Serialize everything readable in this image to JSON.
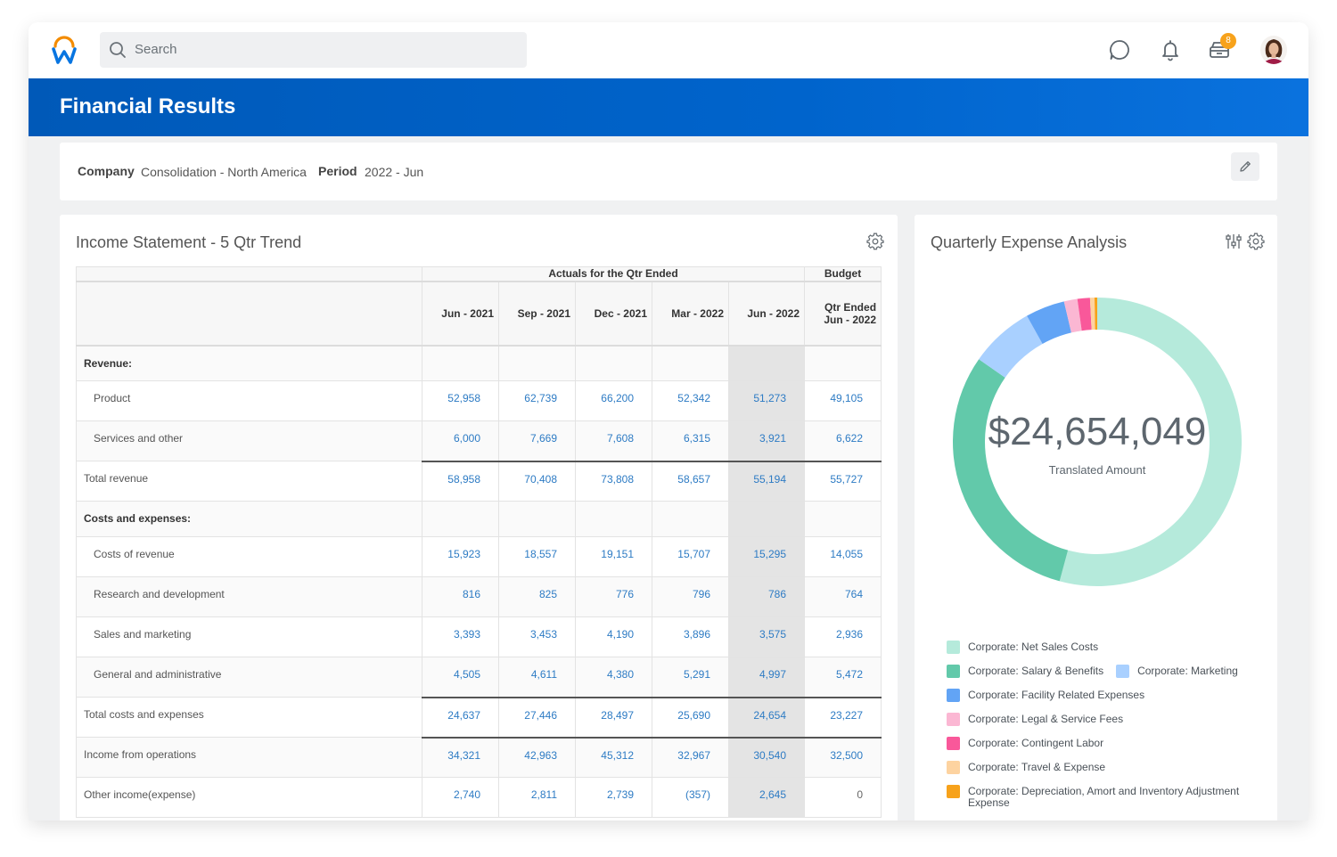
{
  "topbar": {
    "search_placeholder": "Search",
    "notification_badge": "8",
    "colors": {
      "logo_arc": "#f38b00",
      "logo_w": "#0875e1",
      "badge": "#f7a21b"
    }
  },
  "banner": {
    "title": "Financial Results",
    "color": "#0064cc"
  },
  "filters": {
    "company_label": "Company",
    "company_value": "Consolidation - North America",
    "period_label": "Period",
    "period_value": "2022 - Jun"
  },
  "income_statement": {
    "title": "Income Statement - 5 Qtr Trend",
    "group_headers": {
      "actuals": "Actuals for the Qtr Ended",
      "budget": "Budget"
    },
    "columns": [
      "Jun - 2021",
      "Sep - 2021",
      "Dec - 2021",
      "Mar - 2022",
      "Jun - 2022",
      "Qtr Ended Jun - 2022"
    ],
    "rows": [
      {
        "label": "Revenue:",
        "type": "section",
        "values": [
          "",
          "",
          "",
          "",
          "",
          ""
        ]
      },
      {
        "label": "Product",
        "type": "item",
        "values": [
          "52,958",
          "62,739",
          "66,200",
          "52,342",
          "51,273",
          "49,105"
        ]
      },
      {
        "label": "Services and other",
        "type": "item",
        "values": [
          "6,000",
          "7,669",
          "7,608",
          "6,315",
          "3,921",
          "6,622"
        ]
      },
      {
        "label": "Total revenue",
        "type": "total",
        "values": [
          "58,958",
          "70,408",
          "73,808",
          "58,657",
          "55,194",
          "55,727"
        ]
      },
      {
        "label": "Costs and expenses:",
        "type": "section",
        "values": [
          "",
          "",
          "",
          "",
          "",
          ""
        ]
      },
      {
        "label": "Costs of revenue",
        "type": "item",
        "values": [
          "15,923",
          "18,557",
          "19,151",
          "15,707",
          "15,295",
          "14,055"
        ]
      },
      {
        "label": "Research and development",
        "type": "item",
        "values": [
          "816",
          "825",
          "776",
          "796",
          "786",
          "764"
        ]
      },
      {
        "label": "Sales and marketing",
        "type": "item",
        "values": [
          "3,393",
          "3,453",
          "4,190",
          "3,896",
          "3,575",
          "2,936"
        ]
      },
      {
        "label": "General and administrative",
        "type": "item",
        "values": [
          "4,505",
          "4,611",
          "4,380",
          "5,291",
          "4,997",
          "5,472"
        ]
      },
      {
        "label": "Total costs and expenses",
        "type": "total",
        "values": [
          "24,637",
          "27,446",
          "28,497",
          "25,690",
          "24,654",
          "23,227"
        ]
      },
      {
        "label": "Income from operations",
        "type": "total",
        "values": [
          "34,321",
          "42,963",
          "45,312",
          "32,967",
          "30,540",
          "32,500"
        ]
      },
      {
        "label": "Other income(expense)",
        "type": "plain",
        "values": [
          "2,740",
          "2,811",
          "2,739",
          "(357)",
          "2,645",
          "0"
        ]
      }
    ]
  },
  "expense_analysis": {
    "title": "Quarterly Expense Analysis",
    "total_amount": "$24,654,049",
    "total_label": "Translated Amount"
  },
  "chart_data": {
    "type": "pie",
    "variant": "donut",
    "title": "Quarterly Expense Analysis",
    "center_value": "$24,654,049",
    "center_label": "Translated Amount",
    "legend_position": "bottom",
    "slices": [
      {
        "name": "Corporate: Net Sales Costs",
        "percent": 54.2,
        "color": "#b5eadb"
      },
      {
        "name": "Corporate: Salary & Benefits",
        "percent": 30.5,
        "color": "#62c9aa"
      },
      {
        "name": "Corporate: Marketing",
        "percent": 7.2,
        "color": "#a9d0ff"
      },
      {
        "name": "Corporate: Facility Related Expenses",
        "percent": 4.4,
        "color": "#62a4f5"
      },
      {
        "name": "Corporate: Legal & Service Fees",
        "percent": 1.5,
        "color": "#fbb7d3"
      },
      {
        "name": "Corporate: Contingent Labor",
        "percent": 1.4,
        "color": "#f9589a"
      },
      {
        "name": "Corporate: Travel & Expense",
        "percent": 0.5,
        "color": "#fdd3a0"
      },
      {
        "name": "Corporate: Depreciation, Amort and Inventory Adjustment Expense",
        "percent": 0.3,
        "color": "#f7a21b"
      }
    ]
  }
}
